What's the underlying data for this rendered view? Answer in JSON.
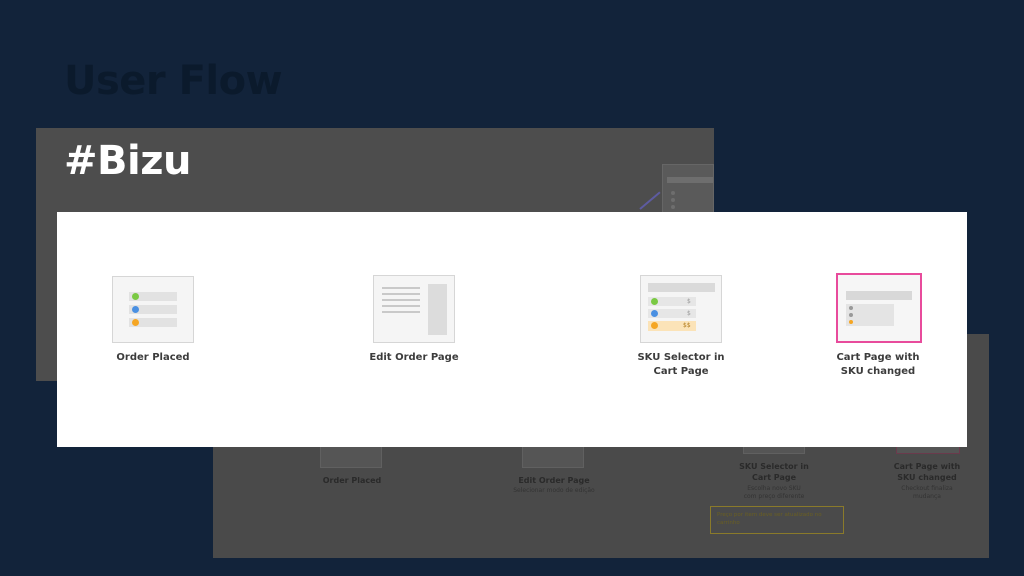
{
  "slide": {
    "title": "User Flow",
    "hashtag": "#Bizu"
  },
  "flow": {
    "steps": [
      {
        "label": "Order Placed"
      },
      {
        "label": "Edit Order Page"
      },
      {
        "label": "SKU Selector in\nCart Page"
      },
      {
        "label": "Cart Page with\nSKU changed"
      }
    ],
    "sku_prices": [
      "$",
      "$",
      "$$"
    ]
  },
  "background_layer": {
    "steps": [
      {
        "label": "Order Placed",
        "sub": ""
      },
      {
        "label": "Edit Order Page",
        "sub": "Selecionar modo de edição"
      },
      {
        "label": "SKU Selector in\nCart Page",
        "sub": "Escolha novo SKU\ncom preço diferente"
      },
      {
        "label": "Cart Page with\nSKU changed",
        "sub": "Checkout finaliza\nmudança"
      }
    ],
    "note": "Preço por item deve ser atualizado no carrinho"
  },
  "colors": {
    "background": "#12233a",
    "highlight": "#e84b9c",
    "green": "#7ac943",
    "blue": "#4a90e2",
    "orange": "#f5a623"
  }
}
